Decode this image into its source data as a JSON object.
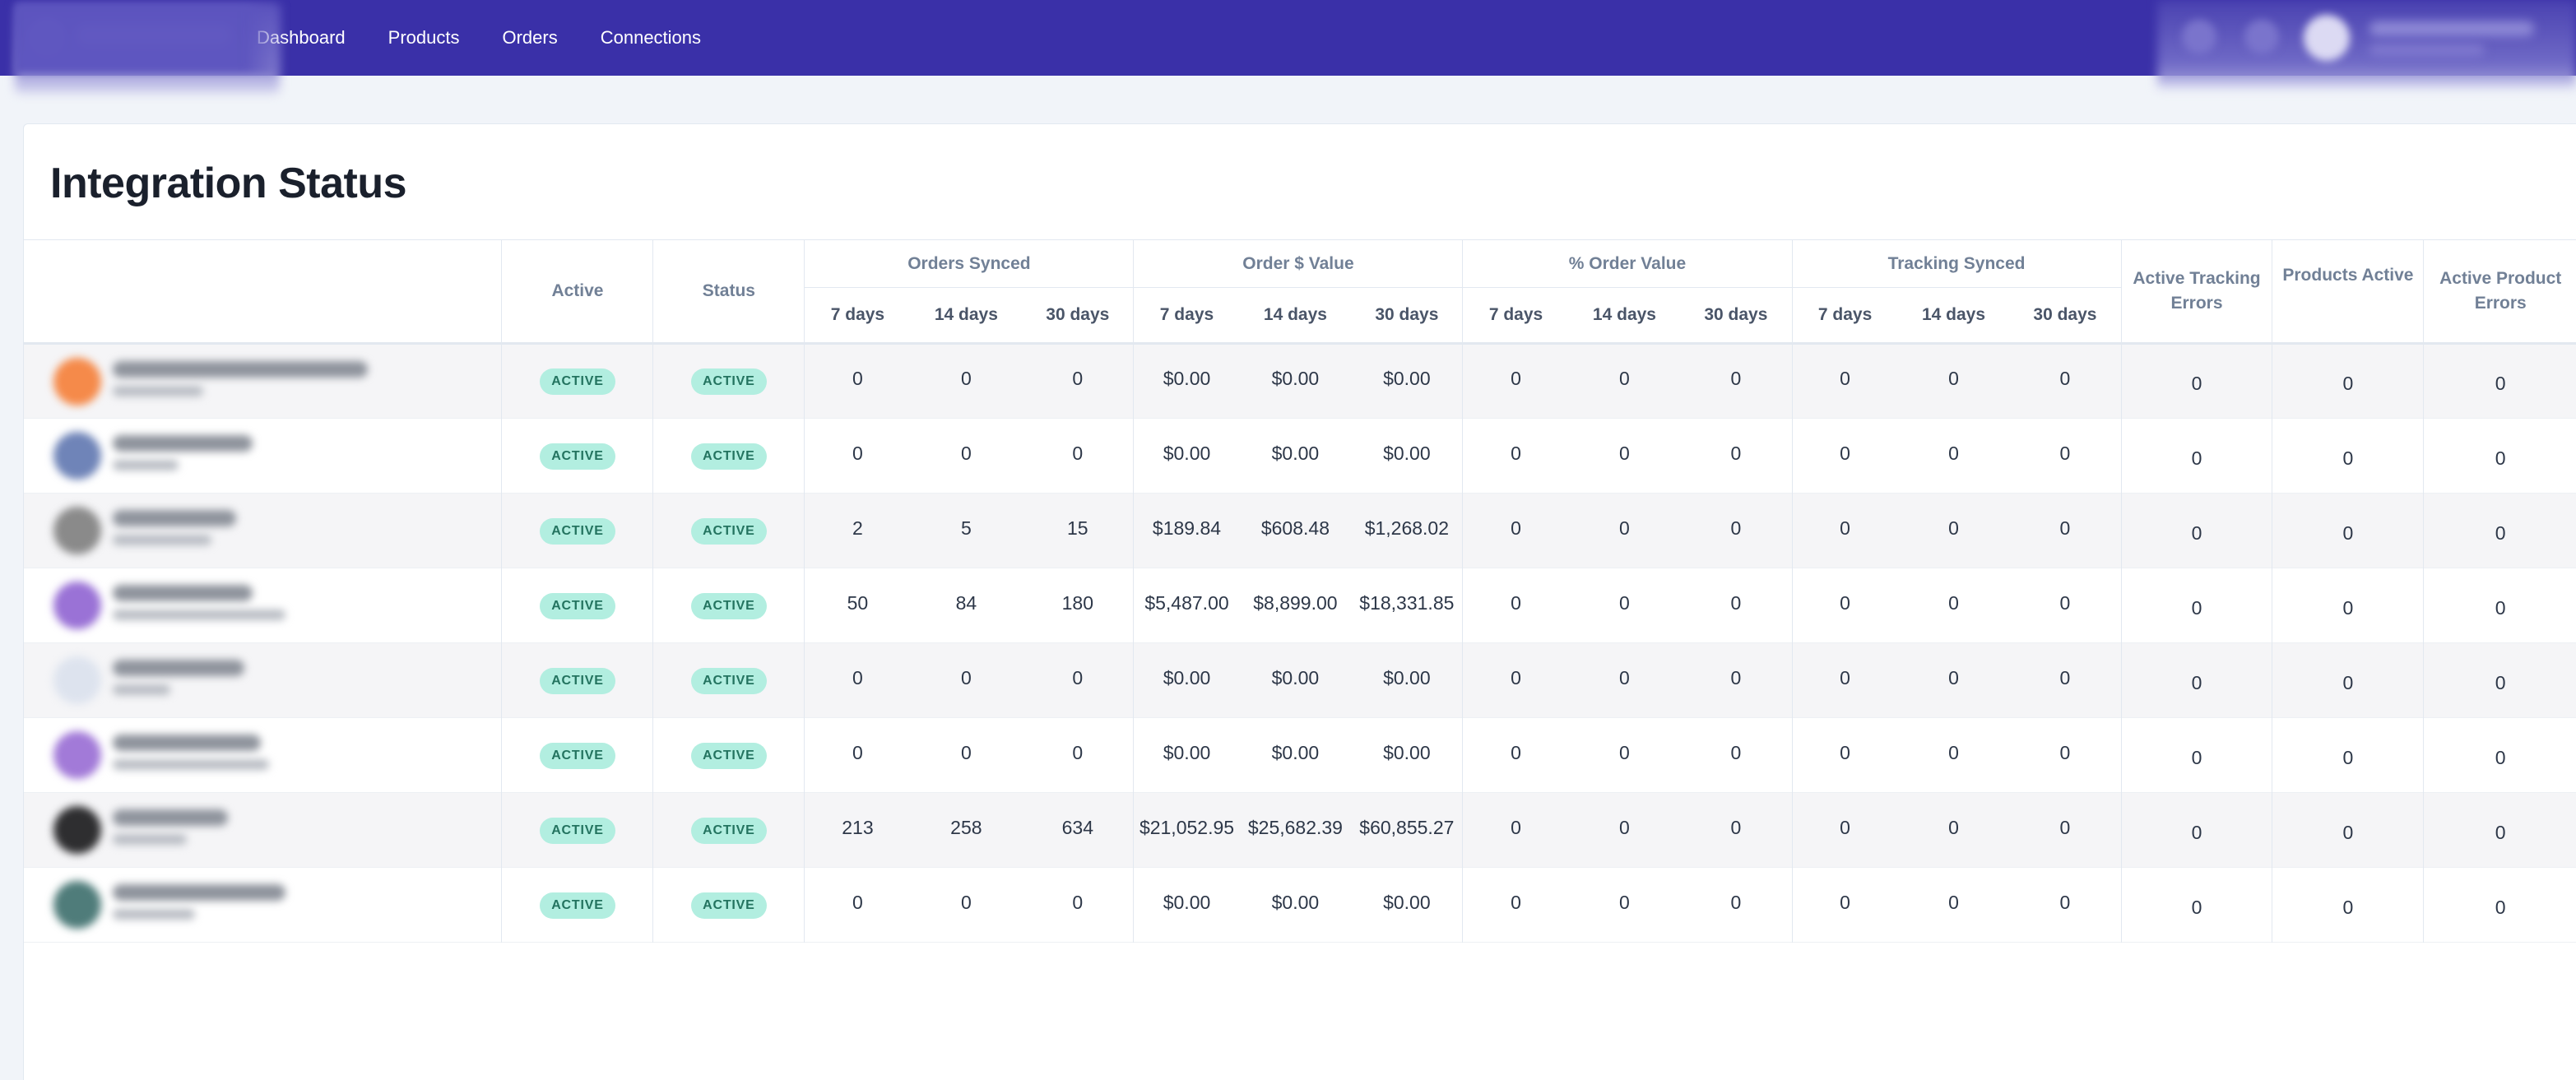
{
  "nav": {
    "items": [
      "Dashboard",
      "Products",
      "Orders",
      "Connections"
    ]
  },
  "page": {
    "title": "Integration Status"
  },
  "table": {
    "headers": {
      "active": "Active",
      "status": "Status",
      "orders_synced": "Orders Synced",
      "order_value": "Order $ Value",
      "pct_order_value": "% Order Value",
      "tracking_synced": "Tracking Synced",
      "active_tracking_errors": "Active Tracking Errors",
      "products_active": "Products Active",
      "active_product_errors": "Active Product Errors",
      "d7": "7 days",
      "d14": "14 days",
      "d30": "30 days"
    },
    "rows": [
      {
        "avatar_color": "#f58a4a",
        "active": "ACTIVE",
        "status": "ACTIVE",
        "orders": [
          "0",
          "0",
          "0"
        ],
        "value": [
          "$0.00",
          "$0.00",
          "$0.00"
        ],
        "pct": [
          "0",
          "0",
          "0"
        ],
        "tracking": [
          "0",
          "0",
          "0"
        ],
        "tracking_errors": "0",
        "products_active": "0",
        "product_errors": "0"
      },
      {
        "avatar_color": "#6f84b8",
        "active": "ACTIVE",
        "status": "ACTIVE",
        "orders": [
          "0",
          "0",
          "0"
        ],
        "value": [
          "$0.00",
          "$0.00",
          "$0.00"
        ],
        "pct": [
          "0",
          "0",
          "0"
        ],
        "tracking": [
          "0",
          "0",
          "0"
        ],
        "tracking_errors": "0",
        "products_active": "0",
        "product_errors": "0"
      },
      {
        "avatar_color": "#8a8a8a",
        "active": "ACTIVE",
        "status": "ACTIVE",
        "orders": [
          "2",
          "5",
          "15"
        ],
        "value": [
          "$189.84",
          "$608.48",
          "$1,268.02"
        ],
        "pct": [
          "0",
          "0",
          "0"
        ],
        "tracking": [
          "0",
          "0",
          "0"
        ],
        "tracking_errors": "0",
        "products_active": "0",
        "product_errors": "0"
      },
      {
        "avatar_color": "#9a72d6",
        "active": "ACTIVE",
        "status": "ACTIVE",
        "orders": [
          "50",
          "84",
          "180"
        ],
        "value": [
          "$5,487.00",
          "$8,899.00",
          "$18,331.85"
        ],
        "pct": [
          "0",
          "0",
          "0"
        ],
        "tracking": [
          "0",
          "0",
          "0"
        ],
        "tracking_errors": "0",
        "products_active": "0",
        "product_errors": "0"
      },
      {
        "avatar_color": "#dde3ee",
        "active": "ACTIVE",
        "status": "ACTIVE",
        "orders": [
          "0",
          "0",
          "0"
        ],
        "value": [
          "$0.00",
          "$0.00",
          "$0.00"
        ],
        "pct": [
          "0",
          "0",
          "0"
        ],
        "tracking": [
          "0",
          "0",
          "0"
        ],
        "tracking_errors": "0",
        "products_active": "0",
        "product_errors": "0"
      },
      {
        "avatar_color": "#a27ad8",
        "active": "ACTIVE",
        "status": "ACTIVE",
        "orders": [
          "0",
          "0",
          "0"
        ],
        "value": [
          "$0.00",
          "$0.00",
          "$0.00"
        ],
        "pct": [
          "0",
          "0",
          "0"
        ],
        "tracking": [
          "0",
          "0",
          "0"
        ],
        "tracking_errors": "0",
        "products_active": "0",
        "product_errors": "0"
      },
      {
        "avatar_color": "#2e2e30",
        "active": "ACTIVE",
        "status": "ACTIVE",
        "orders": [
          "213",
          "258",
          "634"
        ],
        "value": [
          "$21,052.95",
          "$25,682.39",
          "$60,855.27"
        ],
        "pct": [
          "0",
          "0",
          "0"
        ],
        "tracking": [
          "0",
          "0",
          "0"
        ],
        "tracking_errors": "0",
        "products_active": "0",
        "product_errors": "0"
      },
      {
        "avatar_color": "#4f7c7a",
        "active": "ACTIVE",
        "status": "ACTIVE",
        "orders": [
          "0",
          "0",
          "0"
        ],
        "value": [
          "$0.00",
          "$0.00",
          "$0.00"
        ],
        "pct": [
          "0",
          "0",
          "0"
        ],
        "tracking": [
          "0",
          "0",
          "0"
        ],
        "tracking_errors": "0",
        "products_active": "0",
        "product_errors": "0"
      }
    ]
  },
  "colors": {
    "nav_bg": "#3a30a8",
    "badge_bg": "#b2eee0",
    "badge_text": "#23735f"
  }
}
